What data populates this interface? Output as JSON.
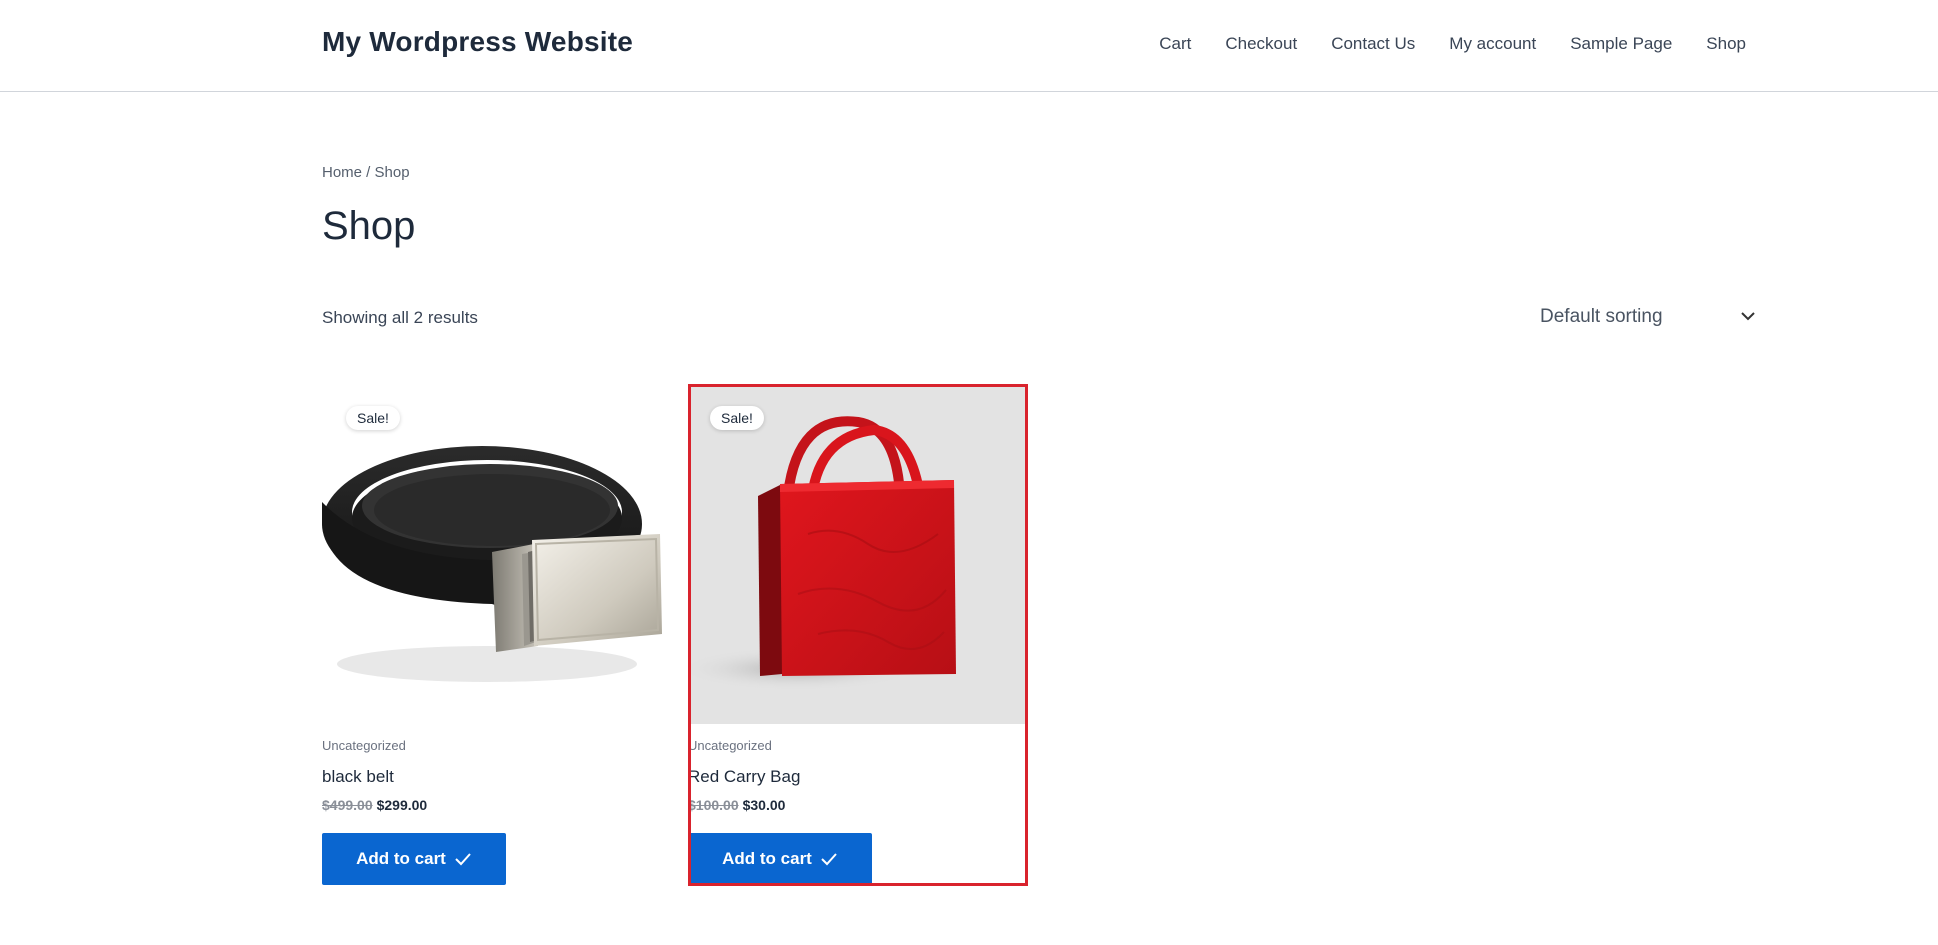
{
  "site": {
    "title": "My Wordpress Website"
  },
  "nav": {
    "items": [
      "Cart",
      "Checkout",
      "Contact Us",
      "My account",
      "Sample Page",
      "Shop"
    ]
  },
  "breadcrumb": {
    "home": "Home",
    "separator": " / ",
    "current": "Shop"
  },
  "page": {
    "title": "Shop"
  },
  "results": {
    "count_text": "Showing all 2 results"
  },
  "sorting": {
    "selected": "Default sorting"
  },
  "products": [
    {
      "badge": "Sale!",
      "category": "Uncategorized",
      "name": "black belt",
      "old_price": "$499.00",
      "price": "$299.00",
      "button_label": "Add to cart",
      "image": "black-leather-belt-image"
    },
    {
      "badge": "Sale!",
      "category": "Uncategorized",
      "name": "Red Carry Bag",
      "old_price": "$100.00",
      "price": "$30.00",
      "button_label": "Add to cart",
      "image": "red-carry-bag-image"
    }
  ],
  "colors": {
    "accent": "#0a66d0",
    "highlight_border": "#d9232d",
    "text": "#1e2a3b",
    "muted": "#6b7280"
  },
  "icons": {
    "check": "check-icon",
    "chevron": "chevron-down-icon"
  }
}
